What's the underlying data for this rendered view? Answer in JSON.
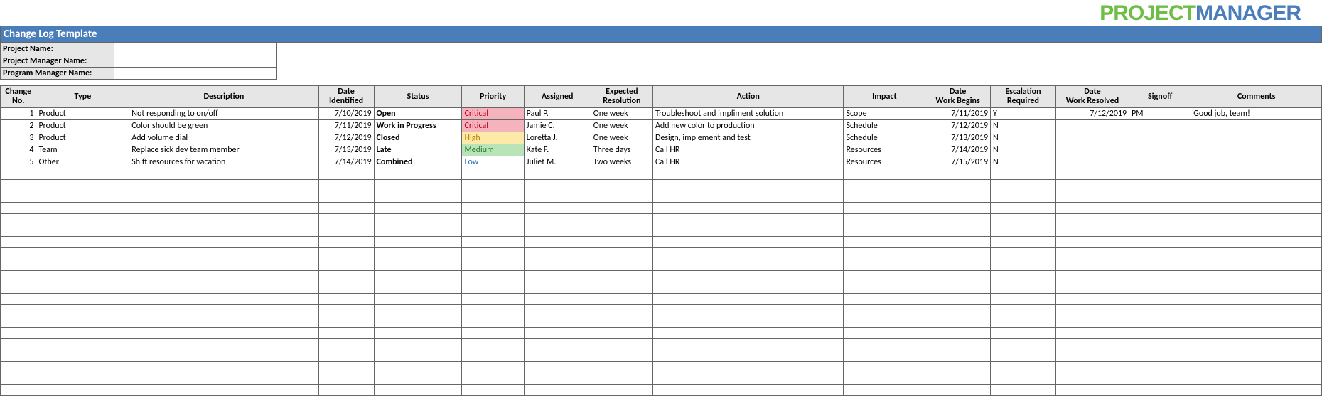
{
  "logo": {
    "part1": "PROJECT",
    "part2": "MANAGER"
  },
  "title": "Change Log Template",
  "meta": {
    "labels": [
      "Project Name:",
      "Project Manager Name:",
      "Program Manager Name:"
    ],
    "values": [
      "",
      "",
      ""
    ]
  },
  "columns": [
    "Change No.",
    "Type",
    "Description",
    "Date Identified",
    "Status",
    "Priority",
    "Assigned",
    "Expected Resolution",
    "Action",
    "Impact",
    "Date Work Begins",
    "Escalation Required",
    "Date Work Resolved",
    "Signoff",
    "Comments"
  ],
  "rows": [
    {
      "no": "1",
      "type": "Product",
      "desc": "Not responding to on/off",
      "date_id": "7/10/2019",
      "status": "Open",
      "priority": "Critical",
      "pclass": "crit",
      "assigned": "Paul P.",
      "expres": "One week",
      "action": "Troubleshoot and impliment solution",
      "impact": "Scope",
      "workbegins": "7/11/2019",
      "escalation": "Y",
      "dateres": "7/12/2019",
      "signoff": "PM",
      "comments": "Good job, team!"
    },
    {
      "no": "2",
      "type": "Product",
      "desc": "Color should be green",
      "date_id": "7/11/2019",
      "status": "Work in Progress",
      "priority": "Critical",
      "pclass": "crit",
      "assigned": "Jamie C.",
      "expres": "One week",
      "action": "Add new color to production",
      "impact": "Schedule",
      "workbegins": "7/12/2019",
      "escalation": "N",
      "dateres": "",
      "signoff": "",
      "comments": ""
    },
    {
      "no": "3",
      "type": "Product",
      "desc": "Add volume dial",
      "date_id": "7/12/2019",
      "status": "Closed",
      "priority": "High",
      "pclass": "high",
      "assigned": "Loretta J.",
      "expres": "One week",
      "action": "Design, implement and test",
      "impact": "Schedule",
      "workbegins": "7/13/2019",
      "escalation": "N",
      "dateres": "",
      "signoff": "",
      "comments": ""
    },
    {
      "no": "4",
      "type": "Team",
      "desc": "Replace sick dev team member",
      "date_id": "7/13/2019",
      "status": "Late",
      "priority": "Medium",
      "pclass": "med",
      "assigned": "Kate F.",
      "expres": "Three days",
      "action": "Call HR",
      "impact": "Resources",
      "workbegins": "7/14/2019",
      "escalation": "N",
      "dateres": "",
      "signoff": "",
      "comments": ""
    },
    {
      "no": "5",
      "type": "Other",
      "desc": "Shift resources for vacation",
      "date_id": "7/14/2019",
      "status": "Combined",
      "priority": "Low",
      "pclass": "low",
      "assigned": "Juliet M.",
      "expres": "Two weeks",
      "action": "Call HR",
      "impact": "Resources",
      "workbegins": "7/15/2019",
      "escalation": "N",
      "dateres": "",
      "signoff": "",
      "comments": ""
    }
  ],
  "empty_rows": 20
}
